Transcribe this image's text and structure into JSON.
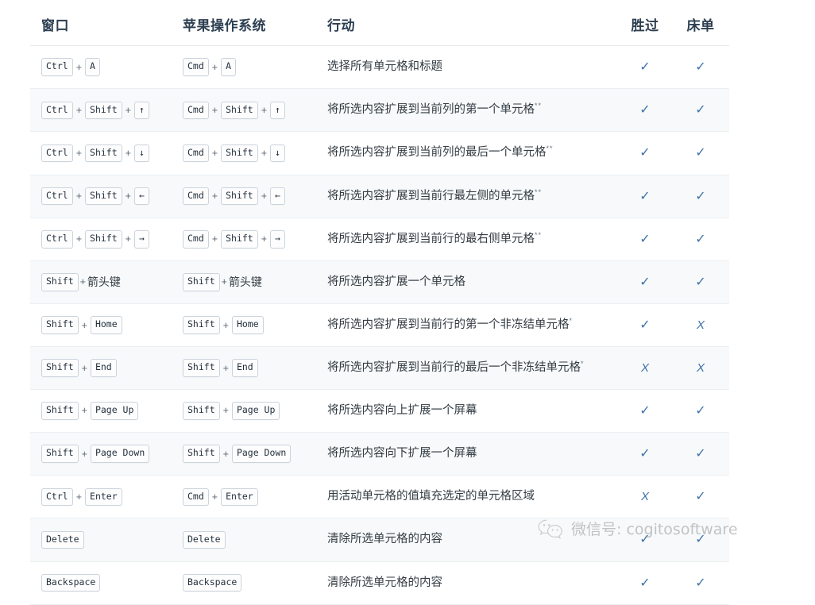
{
  "table": {
    "headers": {
      "windows": "窗口",
      "macos": "苹果操作系统",
      "action": "行动",
      "excel": "胜过",
      "sheets": "床单"
    },
    "rows": [
      {
        "win": [
          {
            "t": "key",
            "v": "Ctrl"
          },
          {
            "t": "plus",
            "v": "+"
          },
          {
            "t": "key",
            "v": "A"
          }
        ],
        "mac": [
          {
            "t": "key",
            "v": "Cmd"
          },
          {
            "t": "plus",
            "v": "+"
          },
          {
            "t": "key",
            "v": "A"
          }
        ],
        "action": "选择所有单元格和标题",
        "note": "",
        "excel": "✓",
        "sheets": "✓"
      },
      {
        "win": [
          {
            "t": "key",
            "v": "Ctrl"
          },
          {
            "t": "plus",
            "v": "+"
          },
          {
            "t": "key",
            "v": "Shift"
          },
          {
            "t": "plus",
            "v": "+"
          },
          {
            "t": "key",
            "v": "↑"
          }
        ],
        "mac": [
          {
            "t": "key",
            "v": "Cmd"
          },
          {
            "t": "plus",
            "v": "+"
          },
          {
            "t": "key",
            "v": "Shift"
          },
          {
            "t": "plus",
            "v": "+"
          },
          {
            "t": "key",
            "v": "↑"
          }
        ],
        "action": "将所选内容扩展到当前列的第一个单元格",
        "note": "**",
        "excel": "✓",
        "sheets": "✓"
      },
      {
        "win": [
          {
            "t": "key",
            "v": "Ctrl"
          },
          {
            "t": "plus",
            "v": "+"
          },
          {
            "t": "key",
            "v": "Shift"
          },
          {
            "t": "plus",
            "v": "+"
          },
          {
            "t": "key",
            "v": "↓"
          }
        ],
        "mac": [
          {
            "t": "key",
            "v": "Cmd"
          },
          {
            "t": "plus",
            "v": "+"
          },
          {
            "t": "key",
            "v": "Shift"
          },
          {
            "t": "plus",
            "v": "+"
          },
          {
            "t": "key",
            "v": "↓"
          }
        ],
        "action": "将所选内容扩展到当前列的最后一个单元格",
        "note": "**",
        "excel": "✓",
        "sheets": "✓"
      },
      {
        "win": [
          {
            "t": "key",
            "v": "Ctrl"
          },
          {
            "t": "plus",
            "v": "+"
          },
          {
            "t": "key",
            "v": "Shift"
          },
          {
            "t": "plus",
            "v": "+"
          },
          {
            "t": "key",
            "v": "←"
          }
        ],
        "mac": [
          {
            "t": "key",
            "v": "Cmd"
          },
          {
            "t": "plus",
            "v": "+"
          },
          {
            "t": "key",
            "v": "Shift"
          },
          {
            "t": "plus",
            "v": "+"
          },
          {
            "t": "key",
            "v": "←"
          }
        ],
        "action": "将所选内容扩展到当前行最左侧的单元格",
        "note": "**",
        "excel": "✓",
        "sheets": "✓"
      },
      {
        "win": [
          {
            "t": "key",
            "v": "Ctrl"
          },
          {
            "t": "plus",
            "v": "+"
          },
          {
            "t": "key",
            "v": "Shift"
          },
          {
            "t": "plus",
            "v": "+"
          },
          {
            "t": "key",
            "v": "→"
          }
        ],
        "mac": [
          {
            "t": "key",
            "v": "Cmd"
          },
          {
            "t": "plus",
            "v": "+"
          },
          {
            "t": "key",
            "v": "Shift"
          },
          {
            "t": "plus",
            "v": "+"
          },
          {
            "t": "key",
            "v": "→"
          }
        ],
        "action": "将所选内容扩展到当前行的最右侧单元格",
        "note": "**",
        "excel": "✓",
        "sheets": "✓"
      },
      {
        "win": [
          {
            "t": "key",
            "v": "Shift"
          },
          {
            "t": "plus-tight",
            "v": "+"
          },
          {
            "t": "text",
            "v": "箭头键"
          }
        ],
        "mac": [
          {
            "t": "key",
            "v": "Shift"
          },
          {
            "t": "plus-tight",
            "v": "+"
          },
          {
            "t": "text",
            "v": "箭头键"
          }
        ],
        "action": "将所选内容扩展一个单元格",
        "note": "",
        "excel": "✓",
        "sheets": "✓"
      },
      {
        "win": [
          {
            "t": "key",
            "v": "Shift"
          },
          {
            "t": "plus",
            "v": "+"
          },
          {
            "t": "key",
            "v": "Home"
          }
        ],
        "mac": [
          {
            "t": "key",
            "v": "Shift"
          },
          {
            "t": "plus",
            "v": "+"
          },
          {
            "t": "key",
            "v": "Home"
          }
        ],
        "action": "将所选内容扩展到当前行的第一个非冻结单元格",
        "note": "*",
        "excel": "✓",
        "sheets": "X"
      },
      {
        "win": [
          {
            "t": "key",
            "v": "Shift"
          },
          {
            "t": "plus",
            "v": "+"
          },
          {
            "t": "key",
            "v": "End"
          }
        ],
        "mac": [
          {
            "t": "key",
            "v": "Shift"
          },
          {
            "t": "plus",
            "v": "+"
          },
          {
            "t": "key",
            "v": "End"
          }
        ],
        "action": "将所选内容扩展到当前行的最后一个非冻结单元格",
        "note": "*",
        "excel": "X",
        "sheets": "X"
      },
      {
        "win": [
          {
            "t": "key",
            "v": "Shift"
          },
          {
            "t": "plus",
            "v": "+"
          },
          {
            "t": "key",
            "v": "Page Up"
          }
        ],
        "mac": [
          {
            "t": "key",
            "v": "Shift"
          },
          {
            "t": "plus",
            "v": "+"
          },
          {
            "t": "key",
            "v": "Page Up"
          }
        ],
        "action": "将所选内容向上扩展一个屏幕",
        "note": "",
        "excel": "✓",
        "sheets": "✓"
      },
      {
        "win": [
          {
            "t": "key",
            "v": "Shift"
          },
          {
            "t": "plus",
            "v": "+"
          },
          {
            "t": "key",
            "v": "Page Down"
          }
        ],
        "mac": [
          {
            "t": "key",
            "v": "Shift"
          },
          {
            "t": "plus",
            "v": "+"
          },
          {
            "t": "key",
            "v": "Page Down"
          }
        ],
        "action": "将所选内容向下扩展一个屏幕",
        "note": "",
        "excel": "✓",
        "sheets": "✓"
      },
      {
        "win": [
          {
            "t": "key",
            "v": "Ctrl"
          },
          {
            "t": "plus",
            "v": "+"
          },
          {
            "t": "key",
            "v": "Enter"
          }
        ],
        "mac": [
          {
            "t": "key",
            "v": "Cmd"
          },
          {
            "t": "plus",
            "v": "+"
          },
          {
            "t": "key",
            "v": "Enter"
          }
        ],
        "action": "用活动单元格的值填充选定的单元格区域",
        "note": "",
        "excel": "X",
        "sheets": "✓"
      },
      {
        "win": [
          {
            "t": "key",
            "v": "Delete"
          }
        ],
        "mac": [
          {
            "t": "key",
            "v": "Delete"
          }
        ],
        "action": "清除所选单元格的内容",
        "note": "",
        "excel": "✓",
        "sheets": "✓"
      },
      {
        "win": [
          {
            "t": "key",
            "v": "Backspace"
          }
        ],
        "mac": [
          {
            "t": "key",
            "v": "Backspace"
          }
        ],
        "action": "清除所选单元格的内容",
        "note": "",
        "excel": "✓",
        "sheets": "✓"
      }
    ]
  },
  "watermark": {
    "icon": "wechat-icon",
    "text": "微信号: cogitosoftware"
  }
}
